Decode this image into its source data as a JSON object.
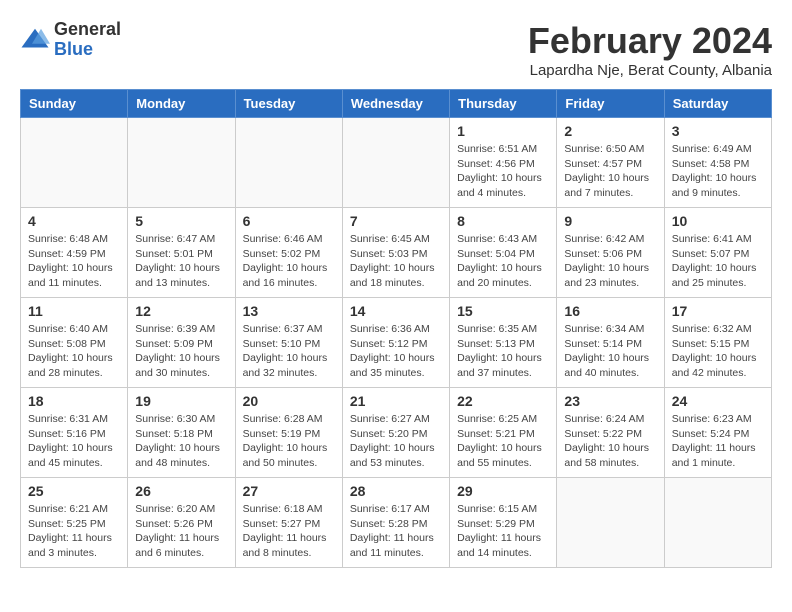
{
  "header": {
    "logo_general": "General",
    "logo_blue": "Blue",
    "month_title": "February 2024",
    "subtitle": "Lapardha Nje, Berat County, Albania"
  },
  "weekdays": [
    "Sunday",
    "Monday",
    "Tuesday",
    "Wednesday",
    "Thursday",
    "Friday",
    "Saturday"
  ],
  "weeks": [
    [
      {
        "day": "",
        "info": ""
      },
      {
        "day": "",
        "info": ""
      },
      {
        "day": "",
        "info": ""
      },
      {
        "day": "",
        "info": ""
      },
      {
        "day": "1",
        "info": "Sunrise: 6:51 AM\nSunset: 4:56 PM\nDaylight: 10 hours\nand 4 minutes."
      },
      {
        "day": "2",
        "info": "Sunrise: 6:50 AM\nSunset: 4:57 PM\nDaylight: 10 hours\nand 7 minutes."
      },
      {
        "day": "3",
        "info": "Sunrise: 6:49 AM\nSunset: 4:58 PM\nDaylight: 10 hours\nand 9 minutes."
      }
    ],
    [
      {
        "day": "4",
        "info": "Sunrise: 6:48 AM\nSunset: 4:59 PM\nDaylight: 10 hours\nand 11 minutes."
      },
      {
        "day": "5",
        "info": "Sunrise: 6:47 AM\nSunset: 5:01 PM\nDaylight: 10 hours\nand 13 minutes."
      },
      {
        "day": "6",
        "info": "Sunrise: 6:46 AM\nSunset: 5:02 PM\nDaylight: 10 hours\nand 16 minutes."
      },
      {
        "day": "7",
        "info": "Sunrise: 6:45 AM\nSunset: 5:03 PM\nDaylight: 10 hours\nand 18 minutes."
      },
      {
        "day": "8",
        "info": "Sunrise: 6:43 AM\nSunset: 5:04 PM\nDaylight: 10 hours\nand 20 minutes."
      },
      {
        "day": "9",
        "info": "Sunrise: 6:42 AM\nSunset: 5:06 PM\nDaylight: 10 hours\nand 23 minutes."
      },
      {
        "day": "10",
        "info": "Sunrise: 6:41 AM\nSunset: 5:07 PM\nDaylight: 10 hours\nand 25 minutes."
      }
    ],
    [
      {
        "day": "11",
        "info": "Sunrise: 6:40 AM\nSunset: 5:08 PM\nDaylight: 10 hours\nand 28 minutes."
      },
      {
        "day": "12",
        "info": "Sunrise: 6:39 AM\nSunset: 5:09 PM\nDaylight: 10 hours\nand 30 minutes."
      },
      {
        "day": "13",
        "info": "Sunrise: 6:37 AM\nSunset: 5:10 PM\nDaylight: 10 hours\nand 32 minutes."
      },
      {
        "day": "14",
        "info": "Sunrise: 6:36 AM\nSunset: 5:12 PM\nDaylight: 10 hours\nand 35 minutes."
      },
      {
        "day": "15",
        "info": "Sunrise: 6:35 AM\nSunset: 5:13 PM\nDaylight: 10 hours\nand 37 minutes."
      },
      {
        "day": "16",
        "info": "Sunrise: 6:34 AM\nSunset: 5:14 PM\nDaylight: 10 hours\nand 40 minutes."
      },
      {
        "day": "17",
        "info": "Sunrise: 6:32 AM\nSunset: 5:15 PM\nDaylight: 10 hours\nand 42 minutes."
      }
    ],
    [
      {
        "day": "18",
        "info": "Sunrise: 6:31 AM\nSunset: 5:16 PM\nDaylight: 10 hours\nand 45 minutes."
      },
      {
        "day": "19",
        "info": "Sunrise: 6:30 AM\nSunset: 5:18 PM\nDaylight: 10 hours\nand 48 minutes."
      },
      {
        "day": "20",
        "info": "Sunrise: 6:28 AM\nSunset: 5:19 PM\nDaylight: 10 hours\nand 50 minutes."
      },
      {
        "day": "21",
        "info": "Sunrise: 6:27 AM\nSunset: 5:20 PM\nDaylight: 10 hours\nand 53 minutes."
      },
      {
        "day": "22",
        "info": "Sunrise: 6:25 AM\nSunset: 5:21 PM\nDaylight: 10 hours\nand 55 minutes."
      },
      {
        "day": "23",
        "info": "Sunrise: 6:24 AM\nSunset: 5:22 PM\nDaylight: 10 hours\nand 58 minutes."
      },
      {
        "day": "24",
        "info": "Sunrise: 6:23 AM\nSunset: 5:24 PM\nDaylight: 11 hours\nand 1 minute."
      }
    ],
    [
      {
        "day": "25",
        "info": "Sunrise: 6:21 AM\nSunset: 5:25 PM\nDaylight: 11 hours\nand 3 minutes."
      },
      {
        "day": "26",
        "info": "Sunrise: 6:20 AM\nSunset: 5:26 PM\nDaylight: 11 hours\nand 6 minutes."
      },
      {
        "day": "27",
        "info": "Sunrise: 6:18 AM\nSunset: 5:27 PM\nDaylight: 11 hours\nand 8 minutes."
      },
      {
        "day": "28",
        "info": "Sunrise: 6:17 AM\nSunset: 5:28 PM\nDaylight: 11 hours\nand 11 minutes."
      },
      {
        "day": "29",
        "info": "Sunrise: 6:15 AM\nSunset: 5:29 PM\nDaylight: 11 hours\nand 14 minutes."
      },
      {
        "day": "",
        "info": ""
      },
      {
        "day": "",
        "info": ""
      }
    ]
  ]
}
